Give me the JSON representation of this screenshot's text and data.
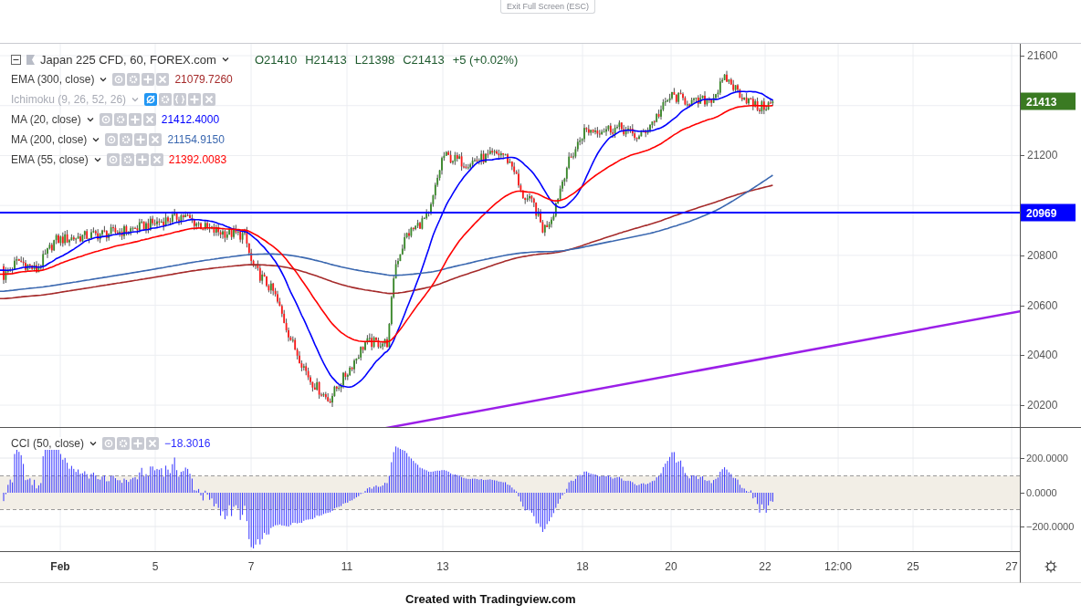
{
  "toolbar": {
    "exit_button": "Exit Full Screen (ESC)"
  },
  "legend": {
    "symbol": "Japan 225 CFD, 60, FOREX.com",
    "ohlc": [
      "O21410",
      "H21413",
      "L21398",
      "C21413",
      "+5 (+0.02%)"
    ]
  },
  "indicators": [
    {
      "name": "EMA (300, close)",
      "value": "21079.7260",
      "color": "#a52a2a",
      "hidden": false,
      "kind": "ema"
    },
    {
      "name": "Ichimoku (9, 26, 52, 26)",
      "hidden": true,
      "kind": "ichimoku"
    },
    {
      "name": "MA (20, close)",
      "value": "21412.4000",
      "color": "#0000ff",
      "hidden": false,
      "kind": "sma"
    },
    {
      "name": "MA (200, close)",
      "value": "21154.9150",
      "color": "#3b68b0",
      "hidden": false,
      "kind": "sma"
    },
    {
      "name": "EMA (55, close)",
      "value": "21392.0083",
      "color": "#ff0000",
      "hidden": false,
      "kind": "ema"
    }
  ],
  "price_axis": {
    "labels": [
      "21600",
      "21200",
      "20800",
      "20600",
      "20400",
      "20200"
    ]
  },
  "price_tags": [
    {
      "text": "21413",
      "color": "#3a7a22"
    },
    {
      "text": "20969",
      "color": "#0000ff"
    }
  ],
  "cci": {
    "name": "CCI (50, close)",
    "value": "−18.3016",
    "axis_labels": [
      "200.0000",
      "0.0000",
      "−200.0000"
    ]
  },
  "time_axis": [
    {
      "label": "Feb",
      "kind": "month"
    },
    {
      "label": "5",
      "kind": "day"
    },
    {
      "label": "7",
      "kind": "day"
    },
    {
      "label": "11",
      "kind": "day"
    },
    {
      "label": "13",
      "kind": "day"
    },
    {
      "label": "18",
      "kind": "day"
    },
    {
      "label": "20",
      "kind": "day"
    },
    {
      "label": "22",
      "kind": "day"
    },
    {
      "label": "12:00",
      "kind": "time"
    },
    {
      "label": "25",
      "kind": "day"
    },
    {
      "label": "27",
      "kind": "day"
    }
  ],
  "caption": "Created with Tradingview.com"
}
